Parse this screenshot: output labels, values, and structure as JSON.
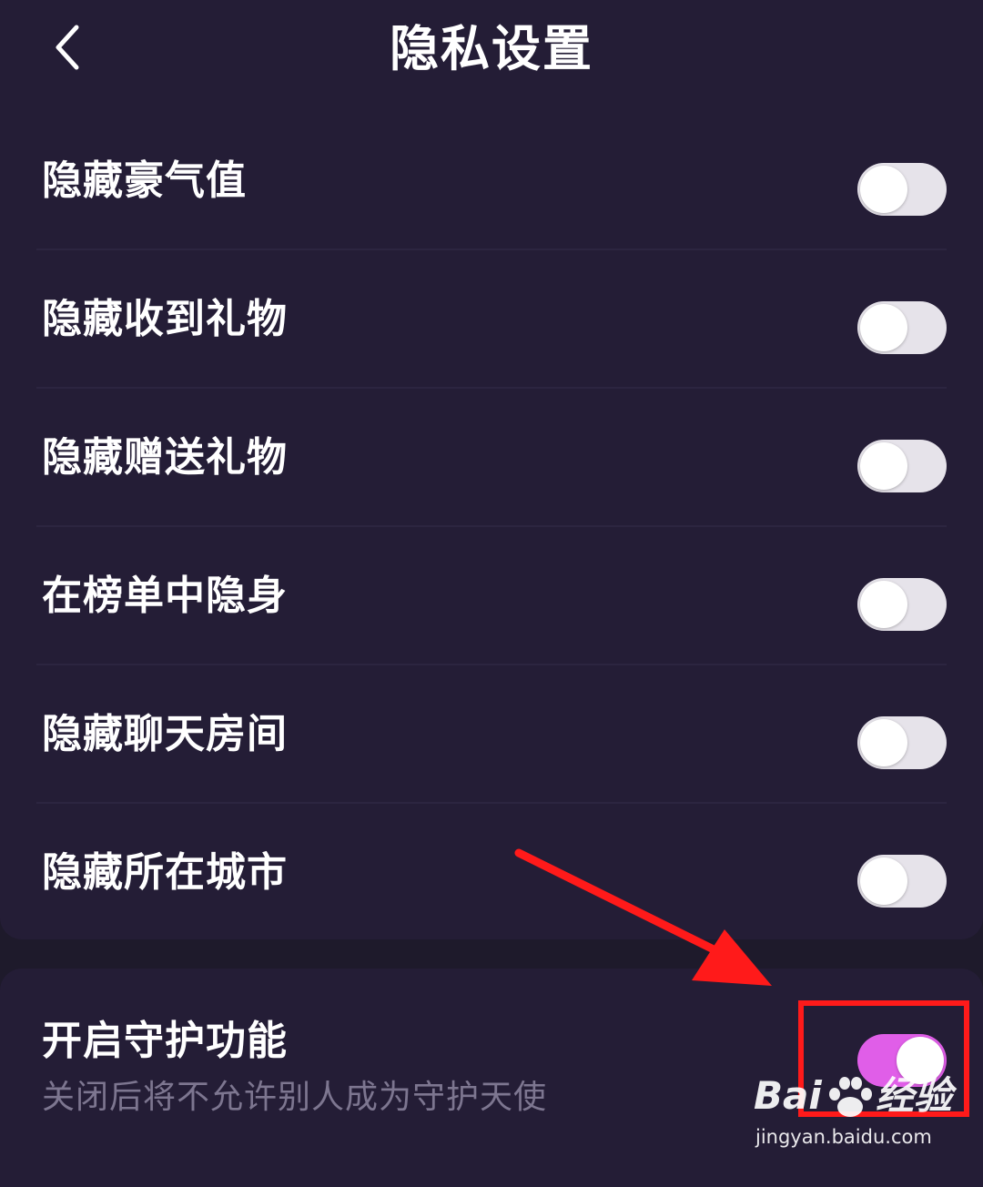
{
  "header": {
    "back_icon": "chevron-left-icon",
    "title": "隐私设置"
  },
  "settings": [
    {
      "label": "隐藏豪气值",
      "enabled": false
    },
    {
      "label": "隐藏收到礼物",
      "enabled": false
    },
    {
      "label": "隐藏赠送礼物",
      "enabled": false
    },
    {
      "label": "在榜单中隐身",
      "enabled": false
    },
    {
      "label": "隐藏聊天房间",
      "enabled": false
    },
    {
      "label": "隐藏所在城市",
      "enabled": false
    }
  ],
  "guardian": {
    "label": "开启守护功能",
    "description": "关闭后将不允许别人成为守护天使",
    "enabled": true
  },
  "watermark": {
    "brand_left": "Bai",
    "brand_right": "经验",
    "url": "jingyan.baidu.com"
  },
  "colors": {
    "background": "#1e1a2b",
    "card": "#241d36",
    "toggle_on": "#e05ee8",
    "toggle_off": "#e6e3ea",
    "annotation": "#ff1a1a"
  }
}
